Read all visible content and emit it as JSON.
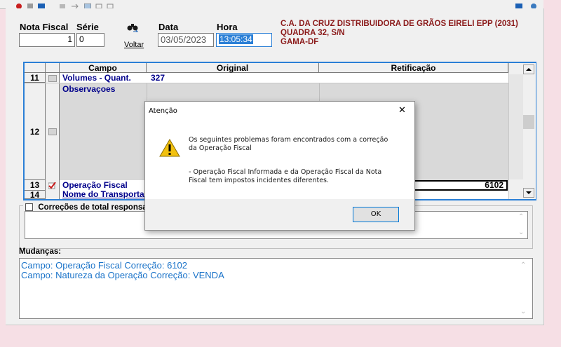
{
  "header": {
    "nota_fiscal_label": "Nota Fiscal",
    "nota_fiscal_value": "1",
    "serie_label": "Série",
    "serie_value": "0",
    "voltar_label": "Voltar",
    "data_label": "Data",
    "data_value": "03/05/2023",
    "hora_label": "Hora",
    "hora_value": "13:05:34",
    "company_line1": "C.A. DA CRUZ DISTRIBUIDORA DE GRÃOS EIRELI EPP (2031)",
    "company_line2": "QUADRA 32, S/N",
    "company_line3": "GAMA-DF"
  },
  "grid": {
    "columns": [
      "Campo",
      "Original",
      "Retificação"
    ],
    "rows": [
      {
        "num": "11",
        "campo": "Volumes - Quant.",
        "original": "327",
        "retificacao": ""
      },
      {
        "num": "12",
        "campo": "Observaçoes",
        "original": "",
        "retificacao": ""
      },
      {
        "num": "13",
        "campo": "Operação Fiscal",
        "original": "",
        "retificacao": "6102"
      },
      {
        "num": "14",
        "campo": "Nome do Transportado",
        "original": "",
        "retificacao": ""
      }
    ]
  },
  "correcoes": {
    "label": "Correções de total responsal"
  },
  "mudancas": {
    "label": "Mudanças:",
    "lines": [
      "Campo: Operação Fiscal Correção: 6102",
      "Campo: Natureza da Operação Correção: VENDA"
    ]
  },
  "dialog": {
    "title": "Atenção",
    "close_glyph": "✕",
    "message_line1": "Os seguintes problemas foram encontrados com a correção",
    "message_line2": "da Operação Fiscal",
    "detail_line1": "- Operação Fiscal Informada e da Operação Fiscal da Nota",
    "detail_line2": "Fiscal tem impostos incidentes diferentes.",
    "ok_label": "OK",
    "icon": "warning-icon"
  },
  "colors": {
    "accent_blue": "#2a7fd6",
    "company_red": "#8b1a1a",
    "field_navy": "#00008b",
    "mudancas_blue": "#1a73c9",
    "background_pink": "#f6dfe5"
  }
}
